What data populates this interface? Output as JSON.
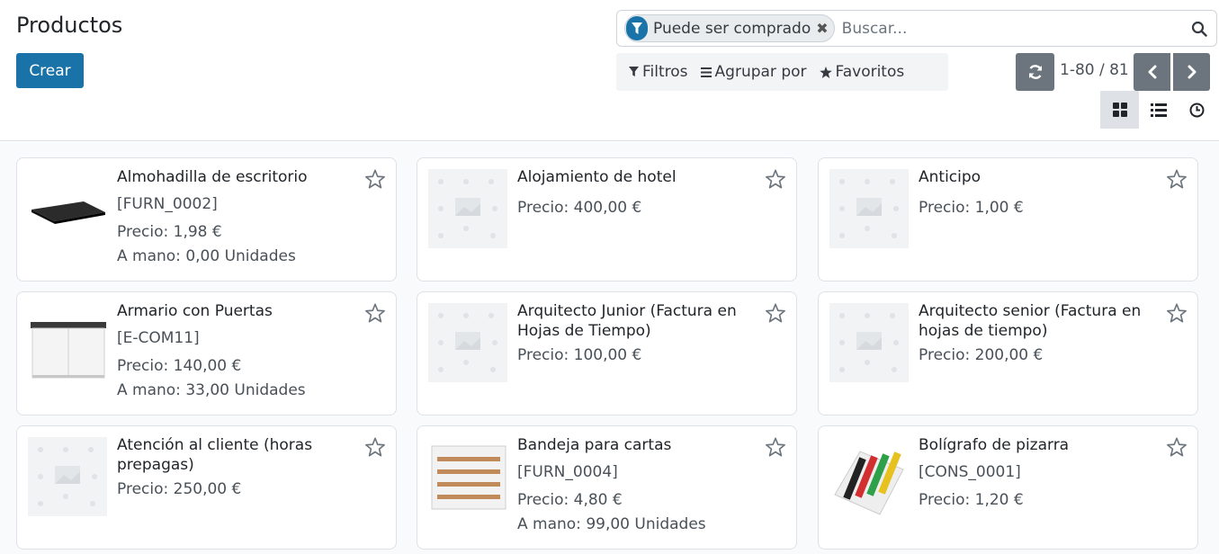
{
  "header": {
    "title": "Productos",
    "create_label": "Crear"
  },
  "search": {
    "facet_label": "Puede ser comprado",
    "placeholder": "Buscar..."
  },
  "filters": {
    "filters_label": "Filtros",
    "group_label": "Agrupar por",
    "favorites_label": "Favoritos"
  },
  "pager": {
    "value": "1-80 / 81"
  },
  "colors": {
    "primary": "#1a73a8",
    "secondary": "#6c757d"
  },
  "cards": [
    {
      "name": "Almohadilla de escritorio",
      "ref": "[FURN_0002]",
      "price": "Precio: 1,98 €",
      "stock": "A mano: 0,00 Unidades",
      "image": "desk-pad"
    },
    {
      "name": "Alojamiento de hotel",
      "ref": "",
      "price": "Precio: 400,00 €",
      "stock": "",
      "image": "placeholder"
    },
    {
      "name": "Anticipo",
      "ref": "",
      "price": "Precio: 1,00 €",
      "stock": "",
      "image": "placeholder"
    },
    {
      "name": "Armario con Puertas",
      "ref": "[E-COM11]",
      "price": "Precio: 140,00 €",
      "stock": "A mano: 33,00 Unidades",
      "image": "cabinet"
    },
    {
      "name": "Arquitecto Junior (Factura en Hojas de Tiempo)",
      "ref": "",
      "price": "Precio: 100,00 €",
      "stock": "",
      "image": "placeholder"
    },
    {
      "name": "Arquitecto senior (Factura en hojas de tiempo)",
      "ref": "",
      "price": "Precio: 200,00 €",
      "stock": "",
      "image": "placeholder"
    },
    {
      "name": "Atención al cliente (horas prepagas)",
      "ref": "",
      "price": "Precio: 250,00 €",
      "stock": "",
      "image": "placeholder"
    },
    {
      "name": "Bandeja para cartas",
      "ref": "[FURN_0004]",
      "price": "Precio: 4,80 €",
      "stock": "A mano: 99,00 Unidades",
      "image": "letter-tray"
    },
    {
      "name": "Bolígrafo de pizarra",
      "ref": "[CONS_0001]",
      "price": "Precio: 1,20 €",
      "stock": "",
      "image": "markers"
    }
  ]
}
